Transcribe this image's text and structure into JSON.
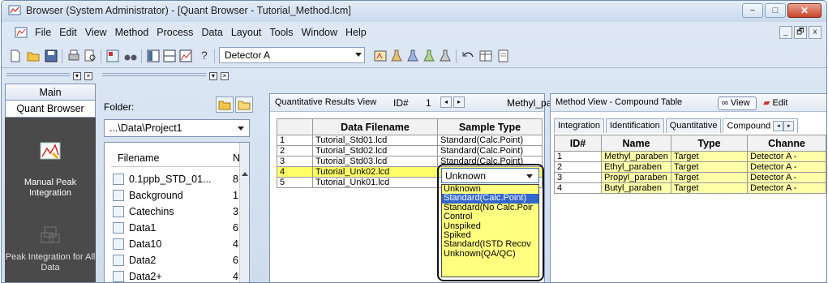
{
  "window": {
    "title": "Browser (System Administrator) - [Quant Browser - Tutorial_Method.lcm]",
    "buttons": [
      "−",
      "□",
      "✕"
    ]
  },
  "menubar": {
    "items": [
      "File",
      "Edit",
      "View",
      "Method",
      "Process",
      "Data",
      "Layout",
      "Tools",
      "Window",
      "Help"
    ],
    "mdi_buttons": [
      "_",
      "🗗",
      "x"
    ]
  },
  "toolbar": {
    "help": "?",
    "detector": "Detector A"
  },
  "assistant": {
    "main_tab": "Main",
    "quant_tab": "Quant Browser",
    "items": [
      {
        "label": "Manual Peak Integration"
      },
      {
        "label": "Peak Integration for All Data"
      }
    ]
  },
  "folder": {
    "label": "Folder:",
    "path": "...\\Data\\Project1",
    "columns": [
      "Filename",
      "N"
    ],
    "files": [
      {
        "name": "0.1ppb_STD_01...",
        "num": "8"
      },
      {
        "name": "Background",
        "num": "1"
      },
      {
        "name": "Catechins",
        "num": "3"
      },
      {
        "name": "Data1",
        "num": "6"
      },
      {
        "name": "Data10",
        "num": "4"
      },
      {
        "name": "Data2",
        "num": "6"
      },
      {
        "name": "Data2+",
        "num": "4"
      }
    ]
  },
  "results": {
    "title": "Quantitative Results View",
    "id_label": "ID#",
    "id_value": "1",
    "compound": "Methyl_pa",
    "columns": [
      "",
      "Data Filename",
      "Sample Type"
    ],
    "rows": [
      {
        "n": "1",
        "file": "Tutorial_Std01.lcd",
        "type": "Standard(Calc.Point)"
      },
      {
        "n": "2",
        "file": "Tutorial_Std02.lcd",
        "type": "Standard(Calc.Point)"
      },
      {
        "n": "3",
        "file": "Tutorial_Std03.lcd",
        "type": "Standard(Calc.Point)"
      },
      {
        "n": "4",
        "file": "Tutorial_Unk02.lcd",
        "type": "Unknown"
      },
      {
        "n": "5",
        "file": "Tutorial_Unk01.lcd",
        "type": ""
      }
    ],
    "dropdown": {
      "selected": "Unknown",
      "options": [
        "Unknown",
        "Standard(Calc.Point)",
        "Standard(No Calc.Poir",
        "Control",
        "Unspiked",
        "Spiked",
        "Standard(ISTD Recov",
        "Unknown(QA/QC)"
      ],
      "highlighted_index": 1
    }
  },
  "method": {
    "title": "Method View - Compound Table",
    "view_btn": "View",
    "edit_btn": "Edit",
    "tabs": [
      "Integration",
      "Identification",
      "Quantitative",
      "Compound"
    ],
    "columns": [
      "ID#",
      "Name",
      "Type",
      "Channe"
    ],
    "rows": [
      {
        "id": "1",
        "name": "Methyl_paraben",
        "type": "Target",
        "ch": "Detector A -"
      },
      {
        "id": "2",
        "name": "Ethyl_paraben",
        "type": "Target",
        "ch": "Detector A -"
      },
      {
        "id": "3",
        "name": "Propyl_paraben",
        "type": "Target",
        "ch": "Detector A -"
      },
      {
        "id": "4",
        "name": "Butyl_paraben",
        "type": "Target",
        "ch": "Detector A -"
      }
    ]
  }
}
